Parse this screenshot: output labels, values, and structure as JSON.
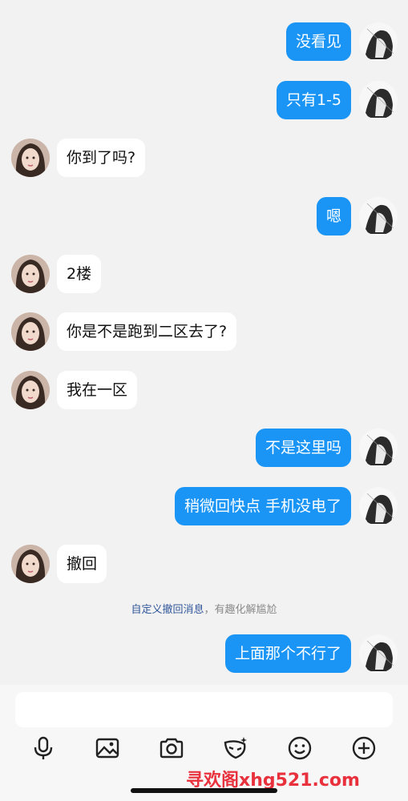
{
  "messages": [
    {
      "side": "out",
      "text": "没看见"
    },
    {
      "side": "out",
      "text": "只有1-5"
    },
    {
      "side": "in",
      "text": "你到了吗?"
    },
    {
      "side": "out",
      "text": "嗯"
    },
    {
      "side": "in",
      "text": "2楼"
    },
    {
      "side": "in",
      "text": "你是不是跑到二区去了?"
    },
    {
      "side": "in",
      "text": "我在一区"
    },
    {
      "side": "out",
      "text": "不是这里吗"
    },
    {
      "side": "out",
      "text": "稍微回快点 手机没电了"
    },
    {
      "side": "in",
      "text": "撤回"
    },
    {
      "side": "out",
      "text": "上面那个不行了"
    }
  ],
  "notice": {
    "link_text": "自定义撤回消息",
    "rest_text": "，有趣化解尴尬"
  },
  "input": {
    "placeholder": ""
  },
  "toolbar": [
    "microphone-icon",
    "image-icon",
    "camera-icon",
    "mask-icon",
    "emoji-icon",
    "plus-icon"
  ],
  "watermark": "寻欢阁xhg521.com",
  "colors": {
    "outgoing_bubble": "#1a95f5",
    "incoming_bubble": "#ffffff",
    "background": "#f2f2f2",
    "notice_link": "#31569a",
    "watermark": "#e8313c"
  }
}
